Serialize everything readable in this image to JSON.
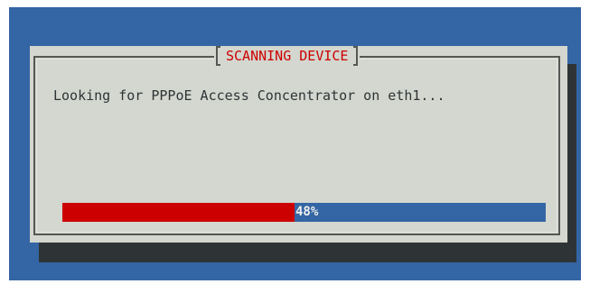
{
  "dialog": {
    "title": "SCANNING DEVICE",
    "message": "Looking for PPPoE Access Concentrator on eth1...",
    "progress": {
      "value": 0.48,
      "label": "48%"
    }
  },
  "colors": {
    "background": "#3465a4",
    "dialog_bg": "#d3d7cf",
    "title": "#cc0000",
    "progress_fill": "#cc0000",
    "progress_track": "#3465a4",
    "shadow": "#2e3436"
  }
}
